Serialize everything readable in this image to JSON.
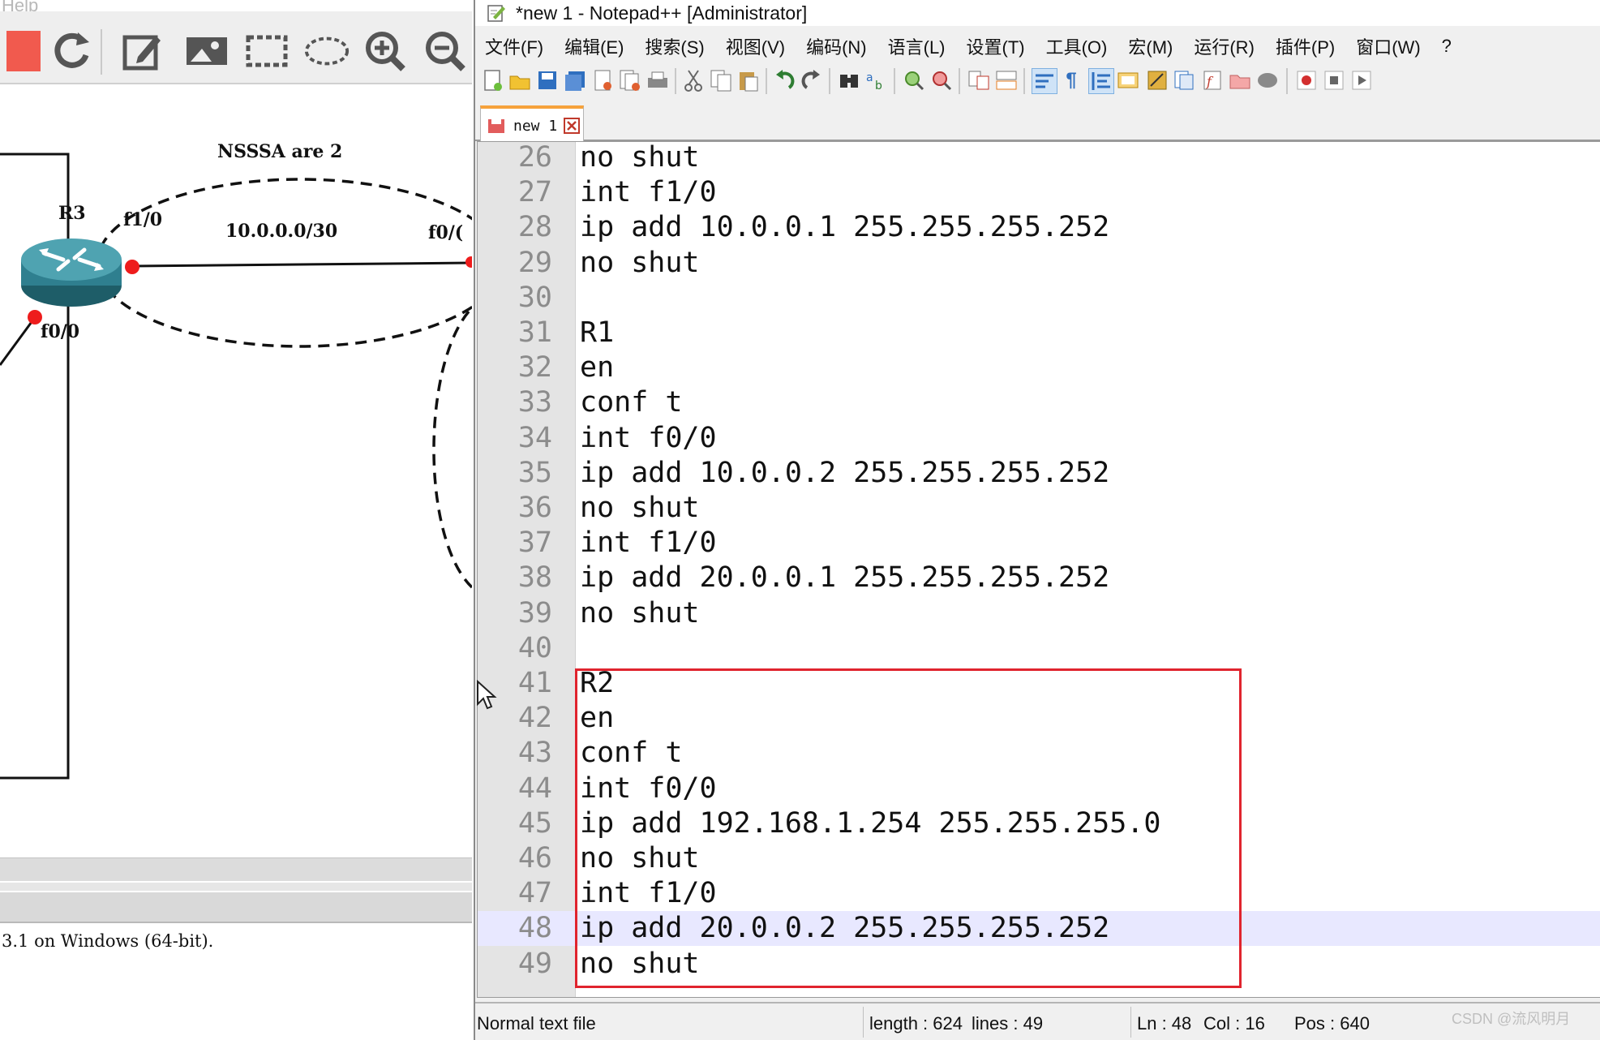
{
  "gns3": {
    "menu_fragment": "Help",
    "diagram": {
      "area_label": "NSSSA  are 2",
      "router_name": "R3",
      "port_f10": "f1/0",
      "link_subnet": "10.0.0.0/30",
      "port_f00_right": "f0/(",
      "port_f00_bottom": "f0/0"
    },
    "console_text": "3.1 on Windows (64-bit)."
  },
  "notepad": {
    "title": "*new 1 - Notepad++ [Administrator]",
    "menu": [
      "文件(F)",
      "编辑(E)",
      "搜索(S)",
      "视图(V)",
      "编码(N)",
      "语言(L)",
      "设置(T)",
      "工具(O)",
      "宏(M)",
      "运行(R)",
      "插件(P)",
      "窗口(W)",
      "?"
    ],
    "tab_label": "new 1",
    "lines": [
      {
        "n": "26",
        "t": "no shut"
      },
      {
        "n": "27",
        "t": "int f1/0"
      },
      {
        "n": "28",
        "t": "ip add 10.0.0.1 255.255.255.252"
      },
      {
        "n": "29",
        "t": "no shut"
      },
      {
        "n": "30",
        "t": ""
      },
      {
        "n": "31",
        "t": "R1"
      },
      {
        "n": "32",
        "t": "en"
      },
      {
        "n": "33",
        "t": "conf t"
      },
      {
        "n": "34",
        "t": "int f0/0"
      },
      {
        "n": "35",
        "t": "ip add 10.0.0.2 255.255.255.252"
      },
      {
        "n": "36",
        "t": "no shut"
      },
      {
        "n": "37",
        "t": "int f1/0"
      },
      {
        "n": "38",
        "t": "ip add 20.0.0.1 255.255.255.252"
      },
      {
        "n": "39",
        "t": "no shut"
      },
      {
        "n": "40",
        "t": ""
      },
      {
        "n": "41",
        "t": "R2"
      },
      {
        "n": "42",
        "t": "en"
      },
      {
        "n": "43",
        "t": "conf t"
      },
      {
        "n": "44",
        "t": "int f0/0"
      },
      {
        "n": "45",
        "t": "ip add 192.168.1.254 255.255.255.0"
      },
      {
        "n": "46",
        "t": "no shut"
      },
      {
        "n": "47",
        "t": "int f1/0"
      },
      {
        "n": "48",
        "t": "ip add 20.0.0.2 255.255.255.252"
      },
      {
        "n": "49",
        "t": "no shut"
      }
    ],
    "current_line": "48",
    "status": {
      "file_type": "Normal text file",
      "length": "length : 624",
      "lines": "lines : 49",
      "ln": "Ln : 48",
      "col": "Col : 16",
      "pos": "Pos : 640"
    },
    "watermark": "CSDN @流风明月"
  },
  "colors": {
    "highlight_box": "#e0242e",
    "current_line": "#e8e8ff",
    "tab_accent": "#f6a23b",
    "router": "#2f7f8f",
    "port_dot": "#ee1c1c"
  }
}
